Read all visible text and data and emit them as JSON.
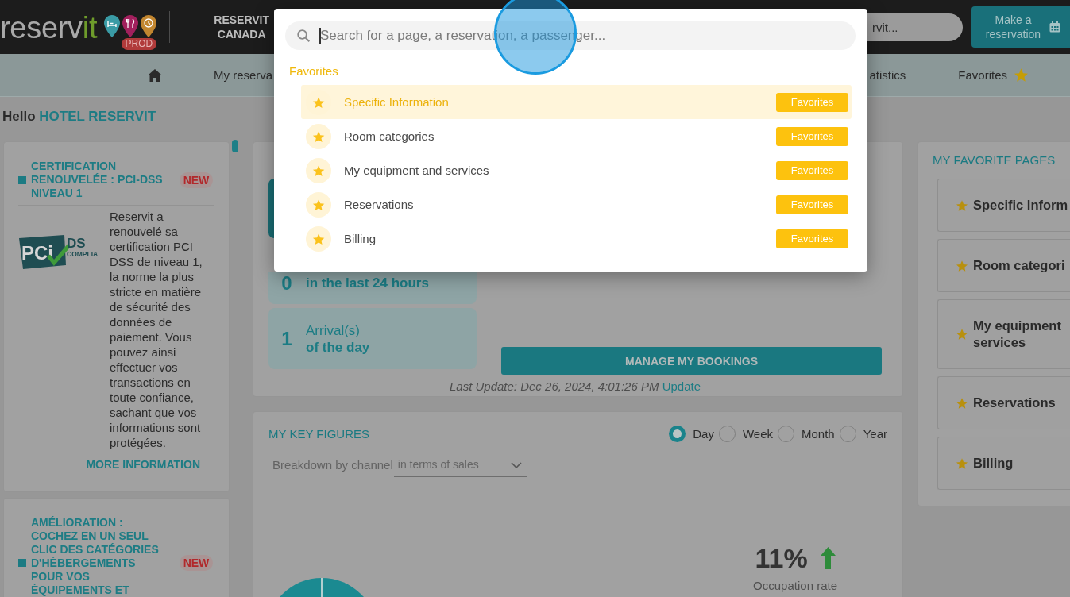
{
  "header": {
    "brand": {
      "main": "reserv",
      "accent": "it",
      "environment": "PROD"
    },
    "account": "RESERVIT CANADA",
    "search": {
      "placeholder": "rvit..."
    },
    "action_button": "Make a reservation"
  },
  "nav": [
    {
      "kind": "home"
    },
    {
      "kind": "link",
      "label": "My reserva"
    },
    {
      "kind": "link",
      "label": "atistics"
    },
    {
      "kind": "starred",
      "label": "Favorites"
    }
  ],
  "greeting": {
    "prefix": "Hello",
    "name": "HOTEL RESERVIT"
  },
  "news": [
    {
      "title": "CERTIFICATION RENOUVELÉE : PCI-DSS NIVEAU 1",
      "badge": "NEW",
      "logo": {
        "mark": "PCi",
        "name": "DS",
        "caption": "COMPLIA"
      },
      "body": "Reservit a renouvelé sa certification PCI DSS de niveau 1, la norme la plus stricte en matière de sécurité des données de paiement. Vous pouvez ainsi effectuer vos transactions en toute confiance, sachant que vos informations sont protégées.",
      "link": "MORE INFORMATION"
    },
    {
      "title": "AMÉLIORATION : COCHEZ EN UN SEUL CLIC DES CATÉGORIES D'HÉBERGEMENTS POUR VOS ÉQUIPEMENTS ET",
      "badge": "NEW"
    }
  ],
  "activity": {
    "tiles": [
      {
        "count": "0",
        "detail": "in the last 24 hours"
      },
      {
        "count": "1",
        "label": "Arrival(s)",
        "detail": "of the day"
      }
    ],
    "manage_button": "MANAGE MY BOOKINGS",
    "last_update": "Last Update: Dec 26, 2024, 4:01:26 PM",
    "update_link": "Update"
  },
  "key_figures": {
    "title": "MY KEY FIGURES",
    "periods": [
      {
        "label": "Day",
        "selected": true
      },
      {
        "label": "Week",
        "selected": false
      },
      {
        "label": "Month",
        "selected": false
      },
      {
        "label": "Year",
        "selected": false
      }
    ],
    "breakdown": {
      "label": "Breakdown by channel",
      "value": "in terms of sales"
    },
    "occupation": {
      "value": "11%",
      "rising": true,
      "label": "Occupation rate"
    }
  },
  "favorite_pages": {
    "title": "MY FAVORITE PAGES",
    "items": [
      "Specific Inform",
      "Room categori",
      "My equipment\nservices",
      "Reservations",
      "Billing"
    ]
  },
  "search_modal": {
    "placeholder": "Search for a page, a reservation, a passenger...",
    "focused": true,
    "section": "Favorites",
    "results": [
      {
        "label": "Specific Information",
        "tag": "Favorites",
        "selected": true
      },
      {
        "label": "Room categories",
        "tag": "Favorites",
        "selected": false
      },
      {
        "label": "My equipment and services",
        "tag": "Favorites",
        "selected": false
      },
      {
        "label": "Reservations",
        "tag": "Favorites",
        "selected": false
      },
      {
        "label": "Billing",
        "tag": "Favorites",
        "selected": false
      }
    ]
  },
  "click_highlight": true
}
